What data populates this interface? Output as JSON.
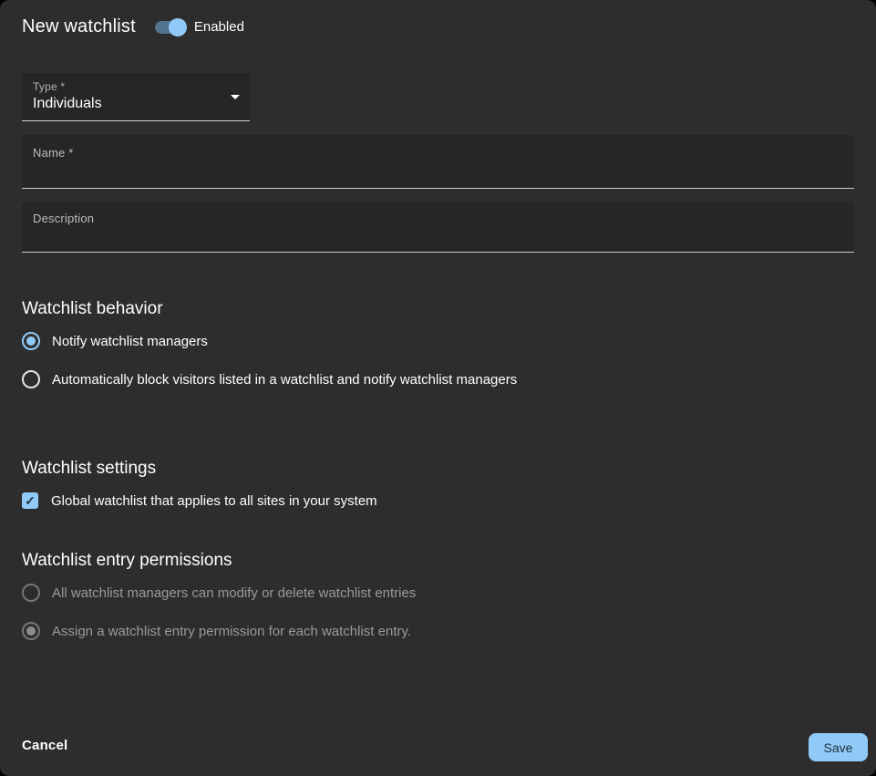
{
  "header": {
    "title": "New watchlist",
    "toggle_label": "Enabled",
    "toggle_state": "on"
  },
  "form": {
    "type_field": {
      "label": "Type *",
      "value": "Individuals"
    },
    "name_field": {
      "label": "Name *",
      "value": ""
    },
    "description_field": {
      "label": "Description",
      "value": ""
    }
  },
  "behavior_section": {
    "heading": "Watchlist behavior",
    "options": [
      {
        "label": "Notify watchlist managers",
        "selected": true,
        "disabled": false
      },
      {
        "label": "Automatically block visitors listed in a watchlist and notify watchlist managers",
        "selected": false,
        "disabled": false
      }
    ]
  },
  "settings_section": {
    "heading": "Watchlist settings",
    "checkbox_label": "Global watchlist that applies to all sites in your system",
    "checked": true
  },
  "permissions_section": {
    "heading": "Watchlist entry permissions",
    "options": [
      {
        "label": "All watchlist managers can modify or delete watchlist entries",
        "selected": false,
        "disabled": true
      },
      {
        "label": "Assign a watchlist entry permission for each watchlist entry.",
        "selected": true,
        "disabled": true
      }
    ]
  },
  "footer": {
    "cancel_label": "Cancel",
    "save_label": "Save"
  },
  "icons": {
    "checkmark": "✓",
    "dropdown_arrow": "caret-down-triangle",
    "toggle": "switch-on"
  },
  "colors": {
    "accent": "#90caf9",
    "toggle_track": "#53748e",
    "dialog_bg": "#2d2d2d",
    "field_bg": "#262626",
    "underline": "#cfcfcf",
    "disabled_text": "#9a9a9a",
    "save_button_text": "#1f2d36"
  }
}
